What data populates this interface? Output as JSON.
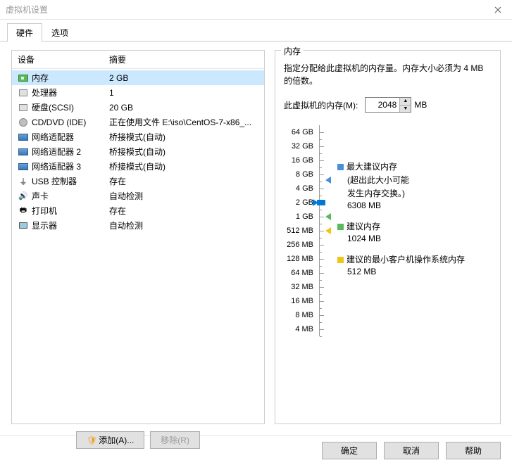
{
  "window": {
    "title": "虚拟机设置"
  },
  "tabs": {
    "hardware": "硬件",
    "options": "选项"
  },
  "columns": {
    "device": "设备",
    "summary": "摘要"
  },
  "devices": [
    {
      "icon": "memory",
      "name": "内存",
      "summary": "2 GB",
      "selected": true
    },
    {
      "icon": "cpu",
      "name": "处理器",
      "summary": "1"
    },
    {
      "icon": "hdd",
      "name": "硬盘(SCSI)",
      "summary": "20 GB"
    },
    {
      "icon": "cd",
      "name": "CD/DVD (IDE)",
      "summary": "正在使用文件 E:\\iso\\CentOS-7-x86_..."
    },
    {
      "icon": "net",
      "name": "网络适配器",
      "summary": "桥接模式(自动)"
    },
    {
      "icon": "net",
      "name": "网络适配器 2",
      "summary": "桥接模式(自动)"
    },
    {
      "icon": "net",
      "name": "网络适配器 3",
      "summary": "桥接模式(自动)"
    },
    {
      "icon": "usb",
      "name": "USB 控制器",
      "summary": "存在"
    },
    {
      "icon": "sound",
      "name": "声卡",
      "summary": "自动检测"
    },
    {
      "icon": "printer",
      "name": "打印机",
      "summary": "存在"
    },
    {
      "icon": "display",
      "name": "显示器",
      "summary": "自动检测"
    }
  ],
  "buttons": {
    "add": "添加(A)...",
    "remove": "移除(R)",
    "ok": "确定",
    "cancel": "取消",
    "help": "帮助"
  },
  "memory": {
    "group_title": "内存",
    "desc": "指定分配给此虚拟机的内存量。内存大小必须为 4 MB 的倍数。",
    "label": "此虚拟机的内存(M):",
    "unit": "MB",
    "value": "2048",
    "ticks": [
      "64 GB",
      "32 GB",
      "16 GB",
      "8 GB",
      "4 GB",
      "2 GB",
      "1 GB",
      "512 MB",
      "256 MB",
      "128 MB",
      "64 MB",
      "32 MB",
      "16 MB",
      "8 MB",
      "4 MB"
    ],
    "legend": {
      "max": {
        "title": "最大建议内存",
        "sub1": "(超出此大小可能",
        "sub2": "发生内存交换。)",
        "value": "6308 MB",
        "color": "#4a90d9"
      },
      "rec": {
        "title": "建议内存",
        "value": "1024 MB",
        "color": "#5bb85b"
      },
      "min": {
        "title": "建议的最小客户机操作系统内存",
        "value": "512 MB",
        "color": "#f0c419"
      }
    }
  }
}
